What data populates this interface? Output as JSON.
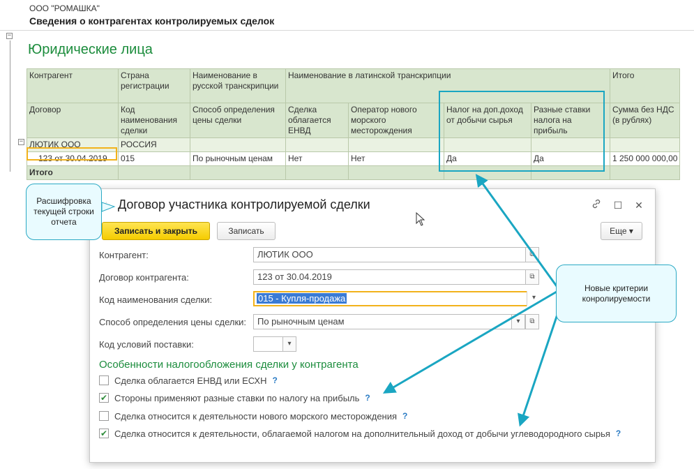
{
  "report": {
    "org": "ООО \"РОМАШКА\"",
    "title": "Сведения о контрагентах контролируемых сделок",
    "section_title": "Юридические лица",
    "tree_minus": "−",
    "header_row1": [
      "Контрагент",
      "Страна регистрации",
      "Наименование в русской транскрипции",
      "Наименование в латинской транскрипции",
      "Итого"
    ],
    "header_row2": [
      "Договор",
      "Код наименования сделки",
      "Способ определения цены сделки",
      "Сделка облагается ЕНВД",
      "Оператор нового морского месторождения",
      "Налог на доп.доход от добычи сырья",
      "Разные ставки налога на прибыль",
      "Сумма без НДС (в рублях)"
    ],
    "group_row": {
      "counterparty": "ЛЮТИК ООО",
      "country": "РОССИЯ"
    },
    "data_row": [
      "123 от 30.04.2019",
      "015",
      "По рыночным ценам",
      "Нет",
      "Нет",
      "Да",
      "Да",
      "1 250 000 000,00"
    ],
    "total_label": "Итого"
  },
  "callouts": {
    "left": "Расшифровка текущей строки отчета",
    "right": "Новые критерии конролируемости"
  },
  "dialog": {
    "title": "Договор участника контролируемой сделки",
    "star_icon": "☆",
    "link_icon": "🔗",
    "maximize_icon": "☐",
    "close_icon": "✕",
    "save_close_label": "Записать и закрыть",
    "save_label": "Записать",
    "more_label": "Еще ▾",
    "fields": {
      "counterparty_label": "Контрагент:",
      "counterparty_value": "ЛЮТИК ООО",
      "contract_label": "Договор контрагента:",
      "contract_value": "123 от 30.04.2019",
      "deal_code_label": "Код наименования сделки:",
      "deal_code_value": "015 - Купля-продажа",
      "price_method_label": "Способ определения цены сделки:",
      "price_method_value": "По рыночным ценам",
      "delivery_code_label": "Код условий поставки:",
      "delivery_code_value": ""
    },
    "tax_section_title": "Особенности налогообложения сделки у контрагента",
    "checks": [
      {
        "label": "Сделка облагается ЕНВД или ЕСХН",
        "checked": false
      },
      {
        "label": "Стороны применяют разные ставки по налогу на прибыль",
        "checked": true
      },
      {
        "label": "Сделка относится к деятельности нового морского месторождения",
        "checked": false
      },
      {
        "label": "Сделка относится к деятельности, облагаемой налогом на дополнительный доход от добычи углеводородного сырья",
        "checked": true
      }
    ],
    "help_mark": "?",
    "check_mark": "✔",
    "open_icon": "⧉",
    "dropdown_icon": "▾"
  },
  "colors": {
    "accent_green": "#1b8c3c",
    "header_bg": "#d8e6ce",
    "primary_button": "#f5cc00",
    "callout_border": "#2aa9c4",
    "arrow": "#1aa6c2",
    "focus_border": "#f2b21b"
  }
}
